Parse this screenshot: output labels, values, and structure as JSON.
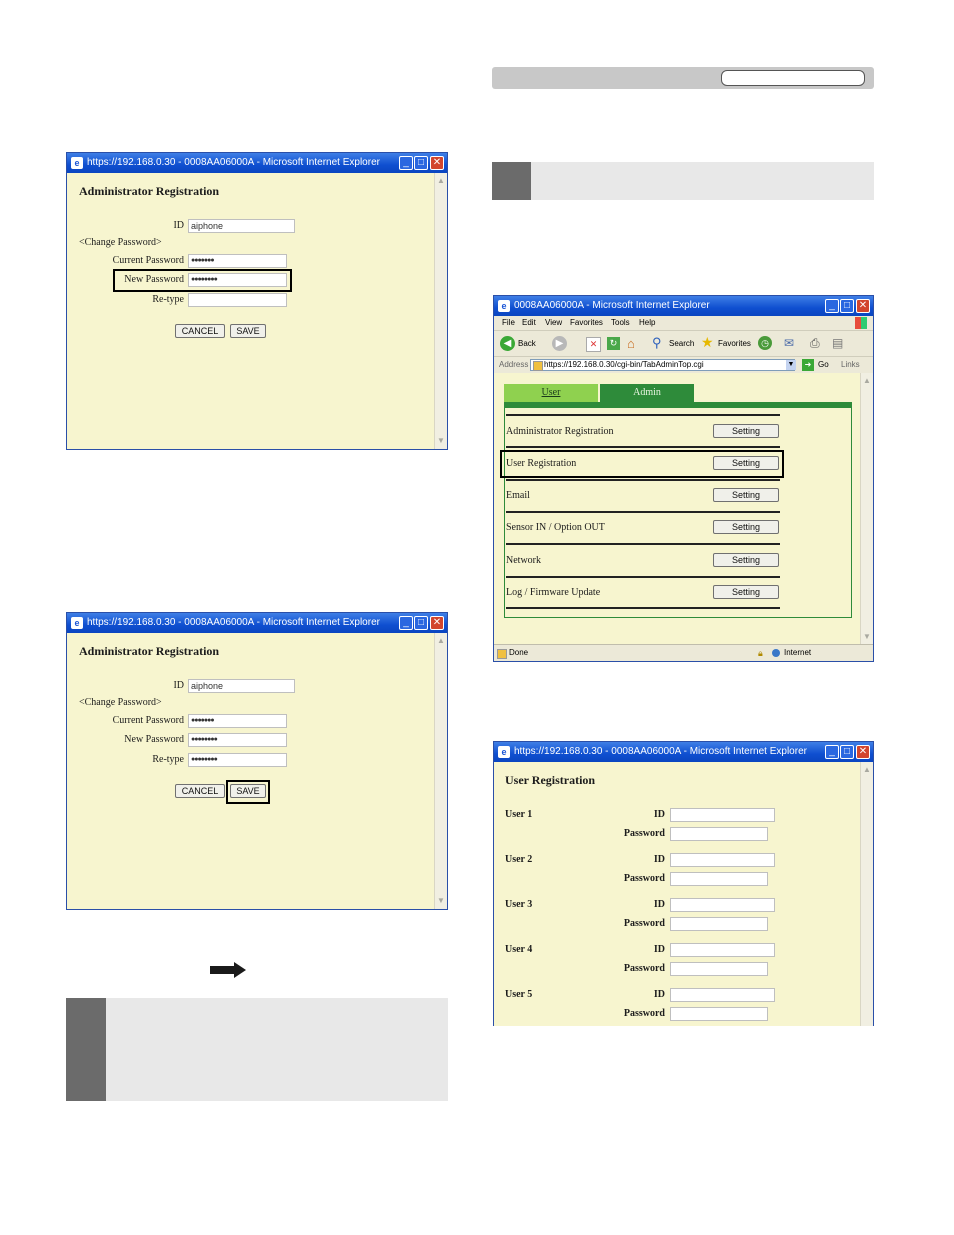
{
  "window1": {
    "title": "https://192.168.0.30 - 0008AA06000A - Microsoft Internet Explorer",
    "heading": "Administrator Registration",
    "id_label": "ID",
    "id_value": "aiphone",
    "change_password_label": "<Change Password>",
    "current_password_label": "Current Password",
    "current_password_value": "●●●●●●●",
    "new_password_label": "New Password",
    "new_password_value": "●●●●●●●●",
    "retype_label": "Re-type",
    "retype_value": "",
    "cancel_label": "CANCEL",
    "save_label": "SAVE"
  },
  "window2": {
    "title": "https://192.168.0.30 - 0008AA06000A - Microsoft Internet Explorer",
    "heading": "Administrator Registration",
    "id_label": "ID",
    "id_value": "aiphone",
    "change_password_label": "<Change Password>",
    "current_password_label": "Current Password",
    "current_password_value": "●●●●●●●",
    "new_password_label": "New Password",
    "new_password_value": "●●●●●●●●",
    "retype_label": "Re-type",
    "retype_value": "●●●●●●●●",
    "cancel_label": "CANCEL",
    "save_label": "SAVE"
  },
  "browser": {
    "title": "0008AA06000A - Microsoft Internet Explorer",
    "menu": [
      "File",
      "Edit",
      "View",
      "Favorites",
      "Tools",
      "Help"
    ],
    "toolbar": {
      "back": "Back",
      "search": "Search",
      "favorites": "Favorites"
    },
    "address_label": "Address",
    "address_value": "https://192.168.0.30/cgi-bin/TabAdminTop.cgi",
    "go_label": "Go",
    "links_label": "Links",
    "tab_user": "User",
    "tab_admin": "Admin",
    "rows": [
      {
        "label": "Administrator Registration",
        "button": "Setting"
      },
      {
        "label": "User Registration",
        "button": "Setting"
      },
      {
        "label": "Email",
        "button": "Setting"
      },
      {
        "label": "Sensor IN / Option OUT",
        "button": "Setting"
      },
      {
        "label": "Network",
        "button": "Setting"
      },
      {
        "label": "Log / Firmware Update",
        "button": "Setting"
      }
    ],
    "status_done": "Done",
    "status_zone": "Internet"
  },
  "window3": {
    "title": "https://192.168.0.30 - 0008AA06000A - Microsoft Internet Explorer",
    "heading": "User Registration",
    "users": [
      {
        "name": "User 1",
        "id_label": "ID",
        "password_label": "Password"
      },
      {
        "name": "User 2",
        "id_label": "ID",
        "password_label": "Password"
      },
      {
        "name": "User 3",
        "id_label": "ID",
        "password_label": "Password"
      },
      {
        "name": "User 4",
        "id_label": "ID",
        "password_label": "Password"
      },
      {
        "name": "User 5",
        "id_label": "ID",
        "password_label": "Password"
      }
    ]
  },
  "colors": {
    "page_bg": "#f7f5cf",
    "titlebar": "#0f4fd0",
    "tab_user": "#8fd14f",
    "tab_admin": "#2e8b3a",
    "step_box": "#6b6b6b",
    "gray_bar": "#c8c8c8"
  }
}
